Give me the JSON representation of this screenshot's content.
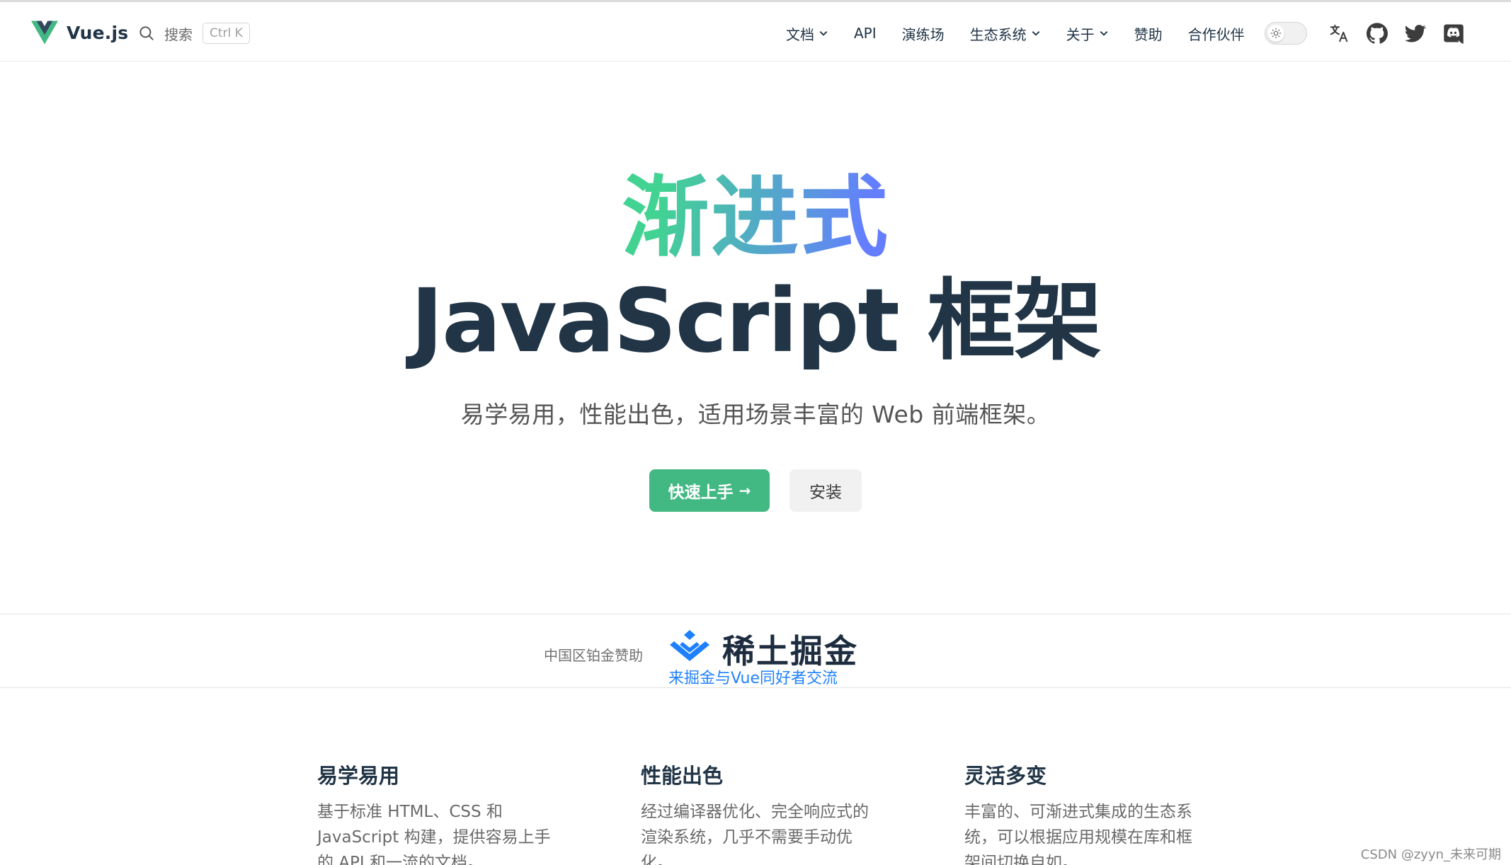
{
  "nav": {
    "brand_name": "Vue.js",
    "search_label": "搜索",
    "search_shortcut": "Ctrl K",
    "items": [
      {
        "label": "文档",
        "has_dropdown": true
      },
      {
        "label": "API",
        "has_dropdown": false
      },
      {
        "label": "演练场",
        "has_dropdown": false
      },
      {
        "label": "生态系统",
        "has_dropdown": true
      },
      {
        "label": "关于",
        "has_dropdown": true
      },
      {
        "label": "赞助",
        "has_dropdown": false
      },
      {
        "label": "合作伙伴",
        "has_dropdown": false
      }
    ],
    "icons": [
      "sun-icon",
      "translate-icon",
      "github-icon",
      "twitter-icon",
      "discord-icon"
    ]
  },
  "hero": {
    "title_highlight": "渐进式",
    "title_main": "JavaScript 框架",
    "tagline": "易学易用，性能出色，适用场景丰富的 Web 前端框架。",
    "primary_button": "快速上手",
    "primary_arrow": "→",
    "secondary_button": "安装"
  },
  "sponsor": {
    "label": "中国区铂金赞助",
    "name": "稀土掘金",
    "slogan": "来掘金与Vue同好者交流"
  },
  "features": [
    {
      "title": "易学易用",
      "text": "基于标准 HTML、CSS 和 JavaScript 构建，提供容易上手的 API 和一流的文档。"
    },
    {
      "title": "性能出色",
      "text": "经过编译器优化、完全响应式的渲染系统，几乎不需要手动优化。"
    },
    {
      "title": "灵活多变",
      "text": "丰富的、可渐进式集成的生态系统，可以根据应用规模在库和框架间切换自如。"
    }
  ],
  "watermark": "CSDN @zyyn_未来可期",
  "colors": {
    "brand_green": "#42b883",
    "gradient_start": "#42d392",
    "gradient_end": "#647eff",
    "text_dark": "#213547",
    "sponsor_blue": "#1e80ff"
  }
}
